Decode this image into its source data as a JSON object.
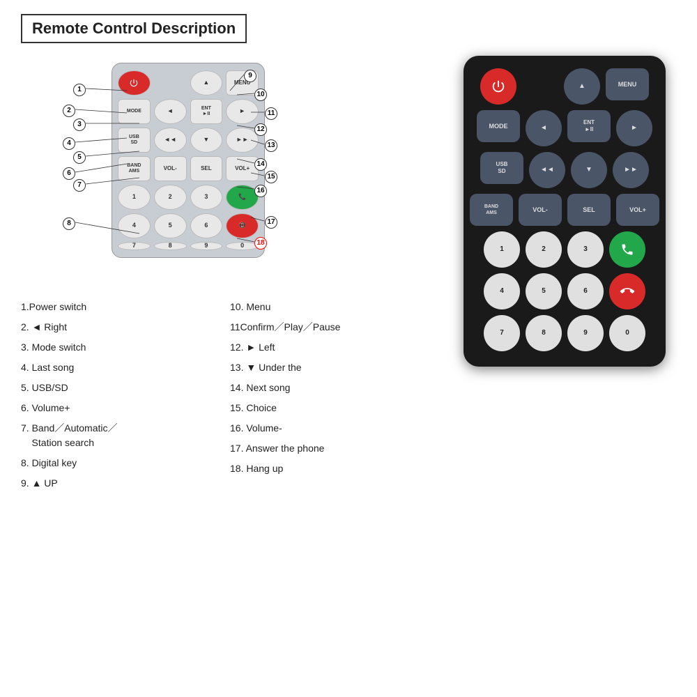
{
  "title": "Remote Control Description",
  "descriptions_left": [
    {
      "num": "1.",
      "text": "Power switch"
    },
    {
      "num": "2.",
      "text": "◄ Right"
    },
    {
      "num": "3.",
      "text": "Mode switch"
    },
    {
      "num": "4.",
      "text": "Last song"
    },
    {
      "num": "5.",
      "text": "USB/SD"
    },
    {
      "num": "6.",
      "text": "Volume+"
    },
    {
      "num": "7.",
      "text": "Band／Automatic／\nStation search"
    },
    {
      "num": "8.",
      "text": "Digital key"
    },
    {
      "num": "9.",
      "text": "▲ UP"
    }
  ],
  "descriptions_right": [
    {
      "num": "10.",
      "text": "Menu"
    },
    {
      "num": "11",
      "text": "Confirm／Play／Pause"
    },
    {
      "num": "12.",
      "text": "► Left"
    },
    {
      "num": "13.",
      "text": "▼ Under the"
    },
    {
      "num": "14.",
      "text": "Next song"
    },
    {
      "num": "15.",
      "text": "Choice"
    },
    {
      "num": "16.",
      "text": "Volume-"
    },
    {
      "num": "17.",
      "text": "Answer the phone"
    },
    {
      "num": "18.",
      "text": "Hang up"
    }
  ],
  "remote": {
    "row1": [
      "PWR",
      "",
      "UP",
      "MENU"
    ],
    "row2": [
      "MODE",
      "◄",
      "ENT\n►II",
      "►"
    ],
    "row3": [
      "USB\nSD",
      "◄◄",
      "▼",
      "►► "
    ],
    "row4": [
      "BAND\nAMS",
      "VOL-",
      "SEL",
      "VOL+"
    ],
    "row5": [
      "1",
      "2",
      "3",
      "📞"
    ],
    "row6": [
      "4",
      "5",
      "6",
      "☎"
    ],
    "row7": [
      "7",
      "8",
      "9",
      "0"
    ]
  }
}
